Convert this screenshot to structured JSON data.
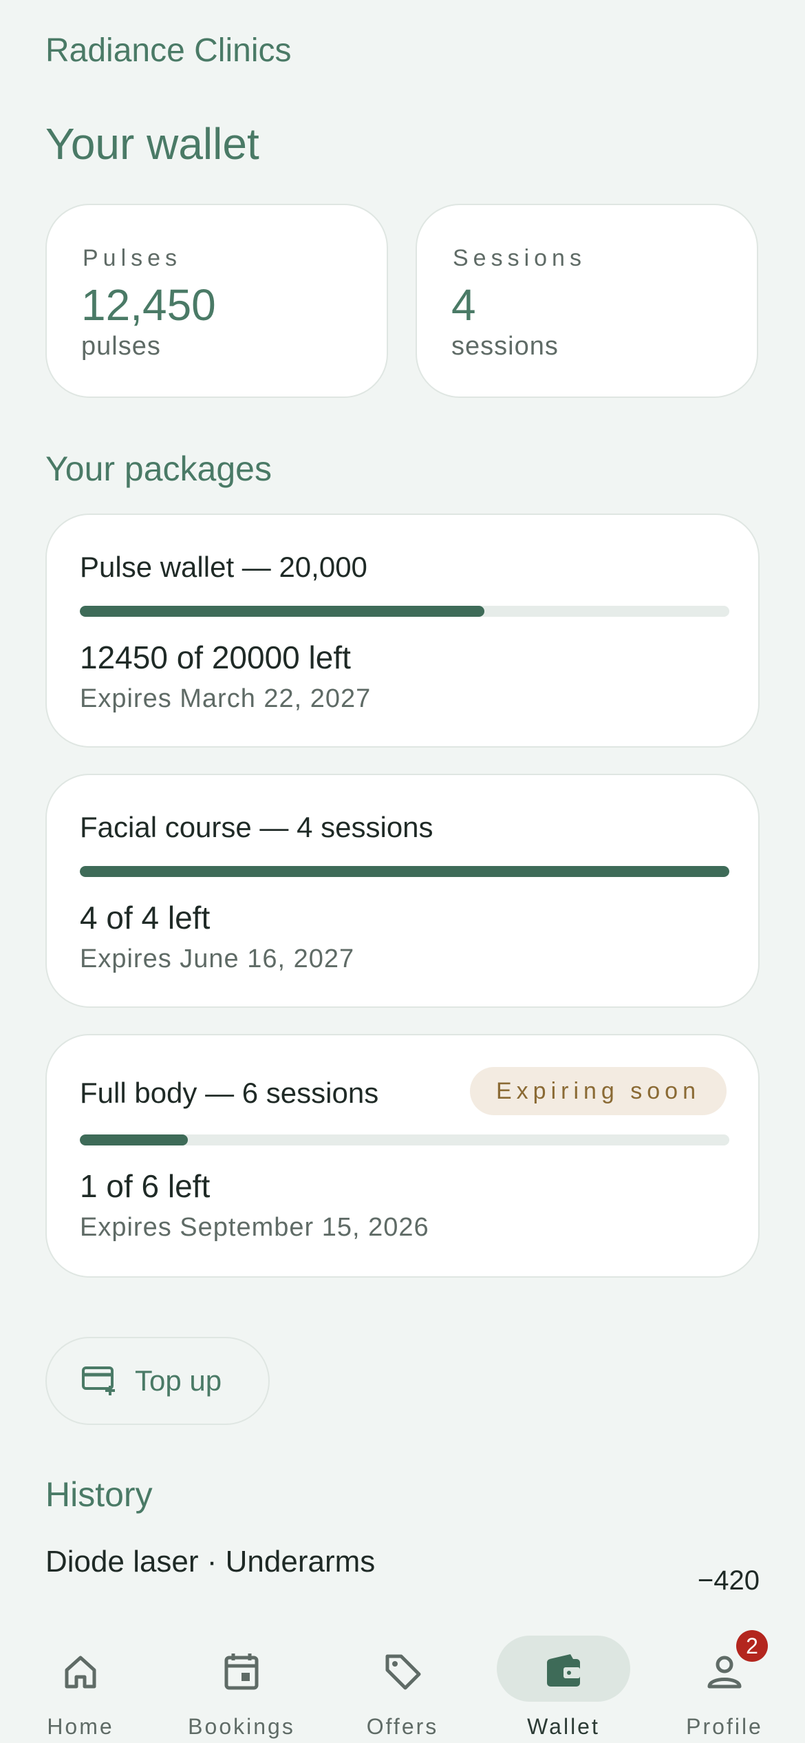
{
  "header": {
    "clinic_name": "Radiance Clinics",
    "page_title": "Your wallet"
  },
  "stats": [
    {
      "label": "Pulses",
      "value": "12,450",
      "unit": "pulses"
    },
    {
      "label": "Sessions",
      "value": "4",
      "unit": "sessions"
    }
  ],
  "packages_title": "Your packages",
  "packages": [
    {
      "title": "Pulse wallet — 20,000",
      "remaining": 12450,
      "total": 20000,
      "left_text": "12450 of 20000 left",
      "expires": "Expires March 22, 2027",
      "badge": ""
    },
    {
      "title": "Facial course — 4 sessions",
      "remaining": 4,
      "total": 4,
      "left_text": "4 of 4 left",
      "expires": "Expires June 16, 2027",
      "badge": ""
    },
    {
      "title": "Full body — 6 sessions",
      "remaining": 1,
      "total": 6,
      "left_text": "1 of 6 left",
      "expires": "Expires September 15, 2026",
      "badge": "Expiring soon"
    }
  ],
  "topup": {
    "label": "Top up",
    "icon": "card-plus-icon"
  },
  "history": {
    "title": "History",
    "items": [
      {
        "description": "Diode laser · Underarms",
        "amount": "−420"
      }
    ]
  },
  "nav": {
    "items": [
      {
        "label": "Home",
        "icon": "home-icon",
        "active": false
      },
      {
        "label": "Bookings",
        "icon": "calendar-icon",
        "active": false
      },
      {
        "label": "Offers",
        "icon": "tag-icon",
        "active": false
      },
      {
        "label": "Wallet",
        "icon": "wallet-icon",
        "active": true
      },
      {
        "label": "Profile",
        "icon": "person-icon",
        "active": false,
        "badge": "2"
      }
    ]
  },
  "colors": {
    "accent": "#3e6b58",
    "heading": "#4a7a66",
    "background": "#f1f5f3",
    "badge_bg": "#f3ebe1",
    "badge_text": "#8a6a34",
    "notification": "#b3261e"
  }
}
